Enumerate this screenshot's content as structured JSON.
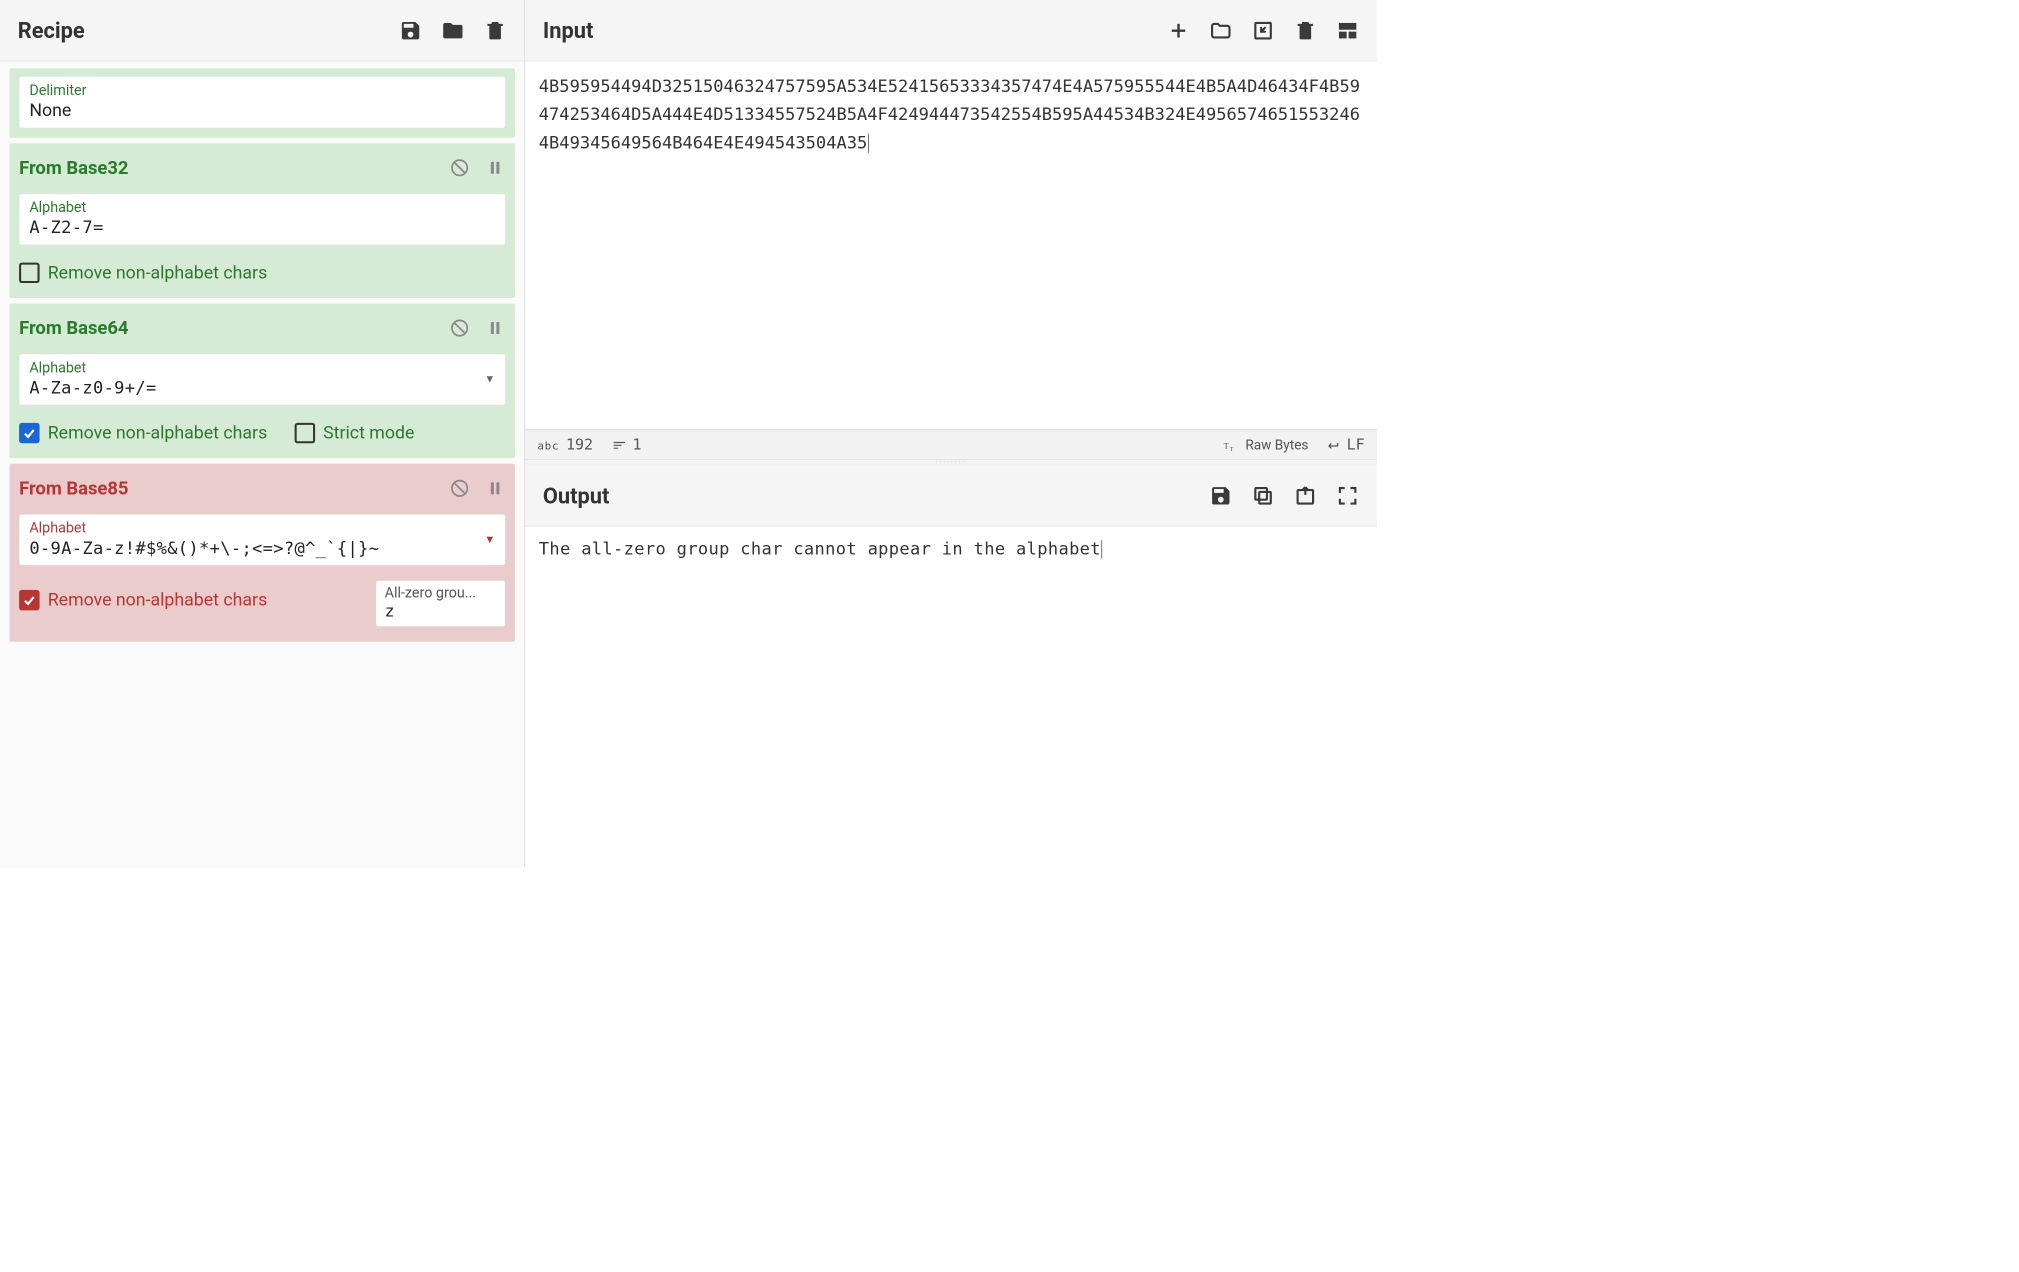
{
  "recipe": {
    "title": "Recipe",
    "partialOp": {
      "fields": {
        "delimiter": {
          "label": "Delimiter",
          "value": "None"
        }
      }
    },
    "ops": [
      {
        "name": "From Base32",
        "style": "green",
        "fields": [
          {
            "key": "alphabet",
            "label": "Alphabet",
            "value": "A-Z2-7=",
            "mono": true
          }
        ],
        "checks": [
          {
            "label": "Remove non-alphabet chars",
            "checked": false
          }
        ]
      },
      {
        "name": "From Base64",
        "style": "green",
        "fields": [
          {
            "key": "alphabet",
            "label": "Alphabet",
            "value": "A-Za-z0-9+/=",
            "mono": true,
            "dropdown": true
          }
        ],
        "checks": [
          {
            "label": "Remove non-alphabet chars",
            "checked": true,
            "color": "blue"
          },
          {
            "label": "Strict mode",
            "checked": false
          }
        ]
      },
      {
        "name": "From Base85",
        "style": "red",
        "fields": [
          {
            "key": "alphabet",
            "label": "Alphabet",
            "value": "0-9A-Za-z!#$%&()*+\\-;<=>?@^_`{|}~",
            "mono": true,
            "dropdown": true
          }
        ],
        "checks": [
          {
            "label": "Remove non-alphabet chars",
            "checked": true,
            "color": "red"
          }
        ],
        "extra": {
          "label": "All-zero grou...",
          "value": "z"
        }
      }
    ]
  },
  "input": {
    "title": "Input",
    "text": "4B595954494D32515046324757595A534E52415653334357474E4A575955544E4B5A4D46434F4B59474253464D5A444E4D51334557524B5A4F424944473542554B595A44534B324E4956574651553246 4B49345649564B464E4E494543504A35",
    "status": {
      "chars": "192",
      "lines": "1",
      "encoding": "Raw Bytes",
      "eol": "LF"
    }
  },
  "output": {
    "title": "Output",
    "text": "The all-zero group char cannot appear in the alphabet"
  }
}
